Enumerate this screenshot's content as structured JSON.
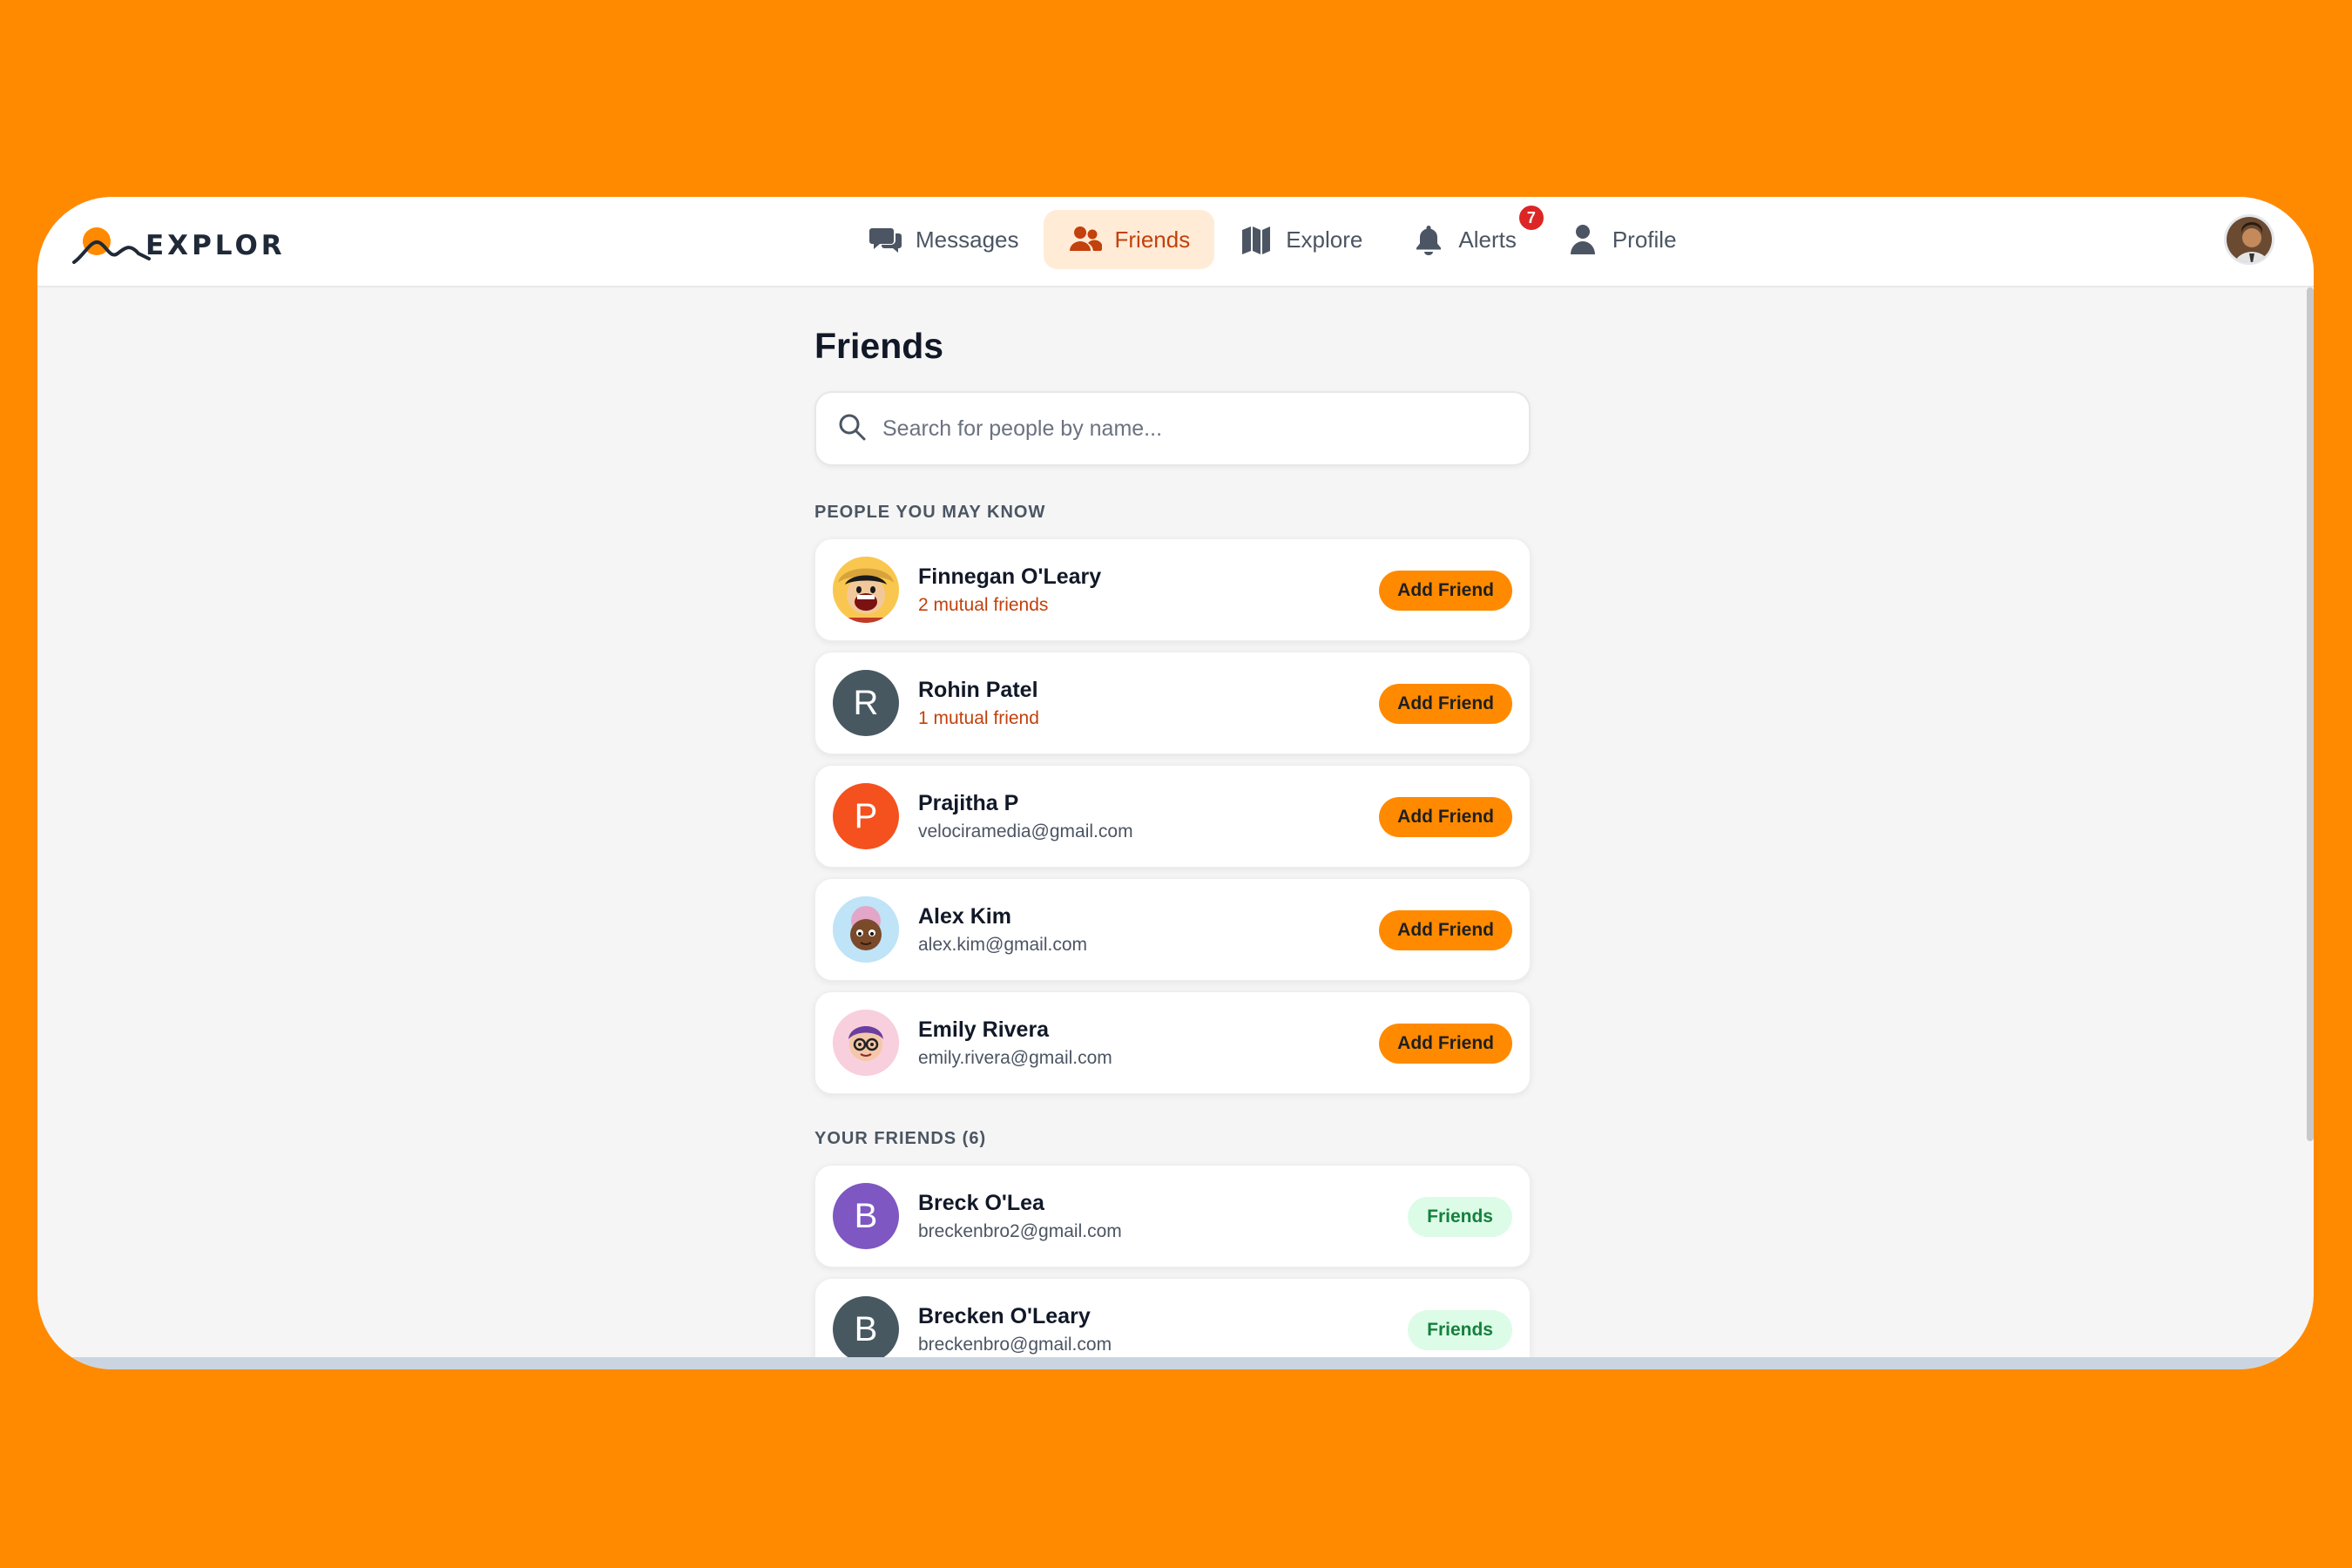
{
  "app": {
    "logo_text": "EXPLOR"
  },
  "nav": {
    "items": [
      {
        "label": "Messages",
        "icon": "chat-icon",
        "active": false
      },
      {
        "label": "Friends",
        "icon": "users-icon",
        "active": true
      },
      {
        "label": "Explore",
        "icon": "map-icon",
        "active": false
      },
      {
        "label": "Alerts",
        "icon": "bell-icon",
        "active": false,
        "badge": "7"
      },
      {
        "label": "Profile",
        "icon": "user-icon",
        "active": false
      }
    ]
  },
  "page": {
    "title": "Friends",
    "search_placeholder": "Search for people by name..."
  },
  "suggestions": {
    "label": "PEOPLE YOU MAY KNOW",
    "action_label": "Add Friend",
    "people": [
      {
        "name": "Finnegan O'Leary",
        "subtitle": "2 mutual friends",
        "subtitle_type": "mutual",
        "avatar": "cartoon-pirate"
      },
      {
        "name": "Rohin Patel",
        "subtitle": "1 mutual friend",
        "subtitle_type": "mutual",
        "avatar_letter": "R",
        "avatar_color": "#475861"
      },
      {
        "name": "Prajitha P",
        "subtitle": "velociramedia@gmail.com",
        "subtitle_type": "email",
        "avatar_letter": "P",
        "avatar_color": "#F4511E"
      },
      {
        "name": "Alex Kim",
        "subtitle": "alex.kim@gmail.com",
        "subtitle_type": "email",
        "avatar": "cartoon-blue"
      },
      {
        "name": "Emily Rivera",
        "subtitle": "emily.rivera@gmail.com",
        "subtitle_type": "email",
        "avatar": "cartoon-pink"
      }
    ]
  },
  "friends": {
    "label": "YOUR FRIENDS (6)",
    "status_label": "Friends",
    "people": [
      {
        "name": "Breck O'Lea",
        "subtitle": "breckenbro2@gmail.com",
        "avatar_letter": "B",
        "avatar_color": "#7E57C2"
      },
      {
        "name": "Brecken O'Leary",
        "subtitle": "breckenbro@gmail.com",
        "avatar_letter": "B",
        "avatar_color": "#475861"
      }
    ]
  },
  "colors": {
    "accent": "#FF8A00",
    "active_nav_bg": "#FFEBD6",
    "active_nav_text": "#C2410C",
    "friends_badge_bg": "#DCFCE7",
    "friends_badge_text": "#15803D",
    "alert_badge": "#DC2626"
  }
}
